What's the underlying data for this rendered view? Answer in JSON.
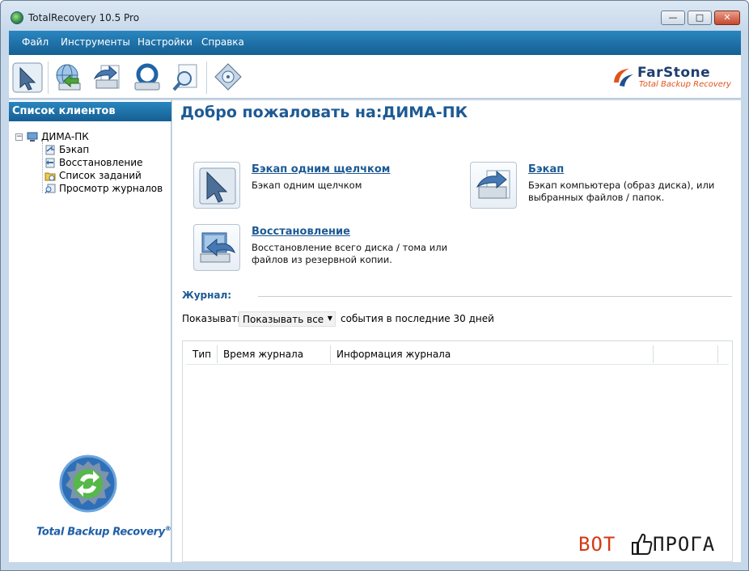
{
  "window": {
    "title": "TotalRecovery 10.5 Pro",
    "controls": {
      "minimize": "▭",
      "maximize": "□",
      "close": "✕"
    }
  },
  "menu": {
    "items": [
      "Файл",
      "Инструменты",
      "Настройки",
      "Справка"
    ]
  },
  "toolbar": {
    "buttons": [
      "one-click-backup-icon",
      "restore-icon",
      "backup-icon",
      "rescue-icon",
      "search-log-icon",
      "settings-icon"
    ],
    "brand_name": "FarStone",
    "brand_tagline": "Total Backup Recovery"
  },
  "left": {
    "header": "Список клиентов",
    "tree": {
      "root": "ДИМА-ПК",
      "expander": "−",
      "items": [
        "Бэкап",
        "Восстановление",
        "Список заданий",
        "Просмотр журналов"
      ]
    },
    "logo_text": "Total Backup Recovery",
    "logo_mark": "®"
  },
  "main": {
    "welcome": "Добро пожаловать на:ДИМА-ПК",
    "actions": [
      {
        "title": "Бэкап одним щелчком",
        "desc_line1": "Бэкап одним щелчком",
        "desc_line2": ""
      },
      {
        "title": "Бэкап",
        "desc_line1": "Бэкап компьютера (образ диска), или",
        "desc_line2": "выбранных файлов / папок."
      },
      {
        "title": "Восстановление",
        "desc_line1": "Восстановление всего диска / тома или",
        "desc_line2": "файлов из резервной копии."
      }
    ],
    "journal": {
      "label": "Журнал:",
      "show_label": "Показывать",
      "filter_value": "Показывать все",
      "filter_tail": "события в последние 30 дней",
      "columns": [
        "Тип",
        "Время журнала",
        "Информация журнала"
      ]
    }
  },
  "watermark": {
    "left": "ВОТ",
    "right": "ПРОГА"
  },
  "colors": {
    "accent": "#1d5a94",
    "menubar": "#1a6fa8",
    "brand_orange": "#e0541a"
  }
}
